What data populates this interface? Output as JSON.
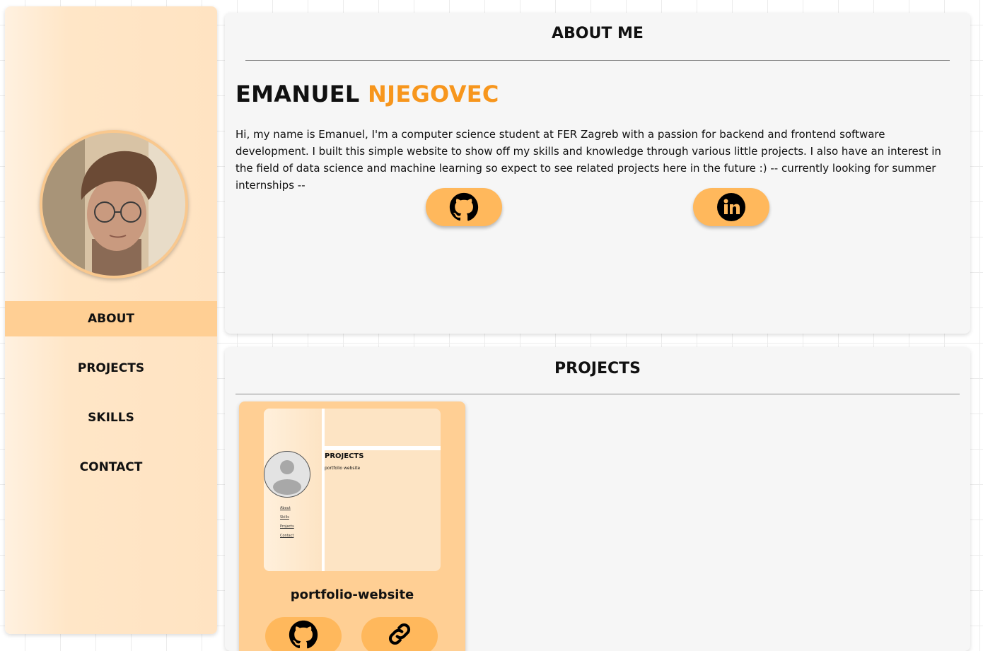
{
  "sidebar": {
    "nav": [
      {
        "label": "ABOUT",
        "active": true
      },
      {
        "label": "PROJECTS",
        "active": false
      },
      {
        "label": "SKILLS",
        "active": false
      },
      {
        "label": "CONTACT",
        "active": false
      }
    ]
  },
  "about": {
    "title": "ABOUT ME",
    "first_name": "EMANUEL",
    "last_name": "NJEGOVEC",
    "bio": "Hi, my name is Emanuel, I'm a computer science student at FER Zagreb with a passion for backend and frontend software development. I built this simple website to show off my skills and knowledge through various little projects. I also have an interest in the field of data science and machine learning so expect to see related projects here in the future :) -- currently looking for summer internships --",
    "social": [
      {
        "icon": "github-icon"
      },
      {
        "icon": "linkedin-icon"
      }
    ]
  },
  "projects": {
    "title": "PROJECTS",
    "cards": [
      {
        "name": "portfolio-website",
        "thumbnail": {
          "title": "PROJECTS",
          "subtitle": "portfolio website",
          "links": [
            "About",
            "Skills",
            "Projects",
            "Contact"
          ]
        },
        "buttons": [
          {
            "icon": "github-icon"
          },
          {
            "icon": "link-icon"
          }
        ]
      }
    ]
  },
  "colors": {
    "accent": "#f7961d",
    "button": "#ffb85c",
    "nav_active": "#ffcf94",
    "panel": "#f6f6f6"
  }
}
